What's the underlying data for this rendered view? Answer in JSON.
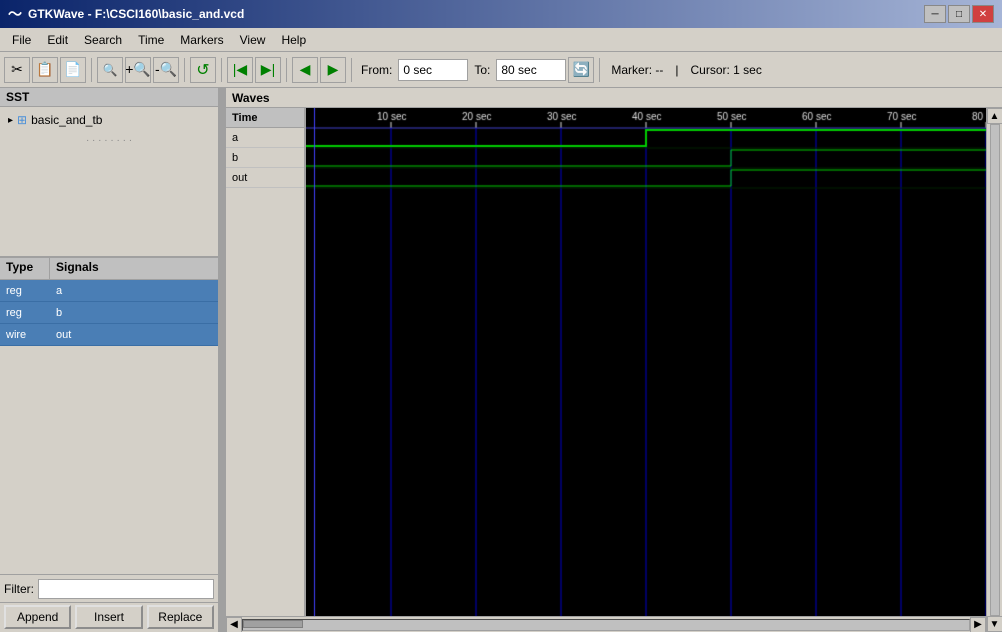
{
  "titlebar": {
    "title": "GTKWave - F:\\CSCI160\\basic_and.vcd",
    "icon": "wave-icon",
    "controls": [
      "minimize",
      "maximize",
      "close"
    ]
  },
  "menubar": {
    "items": [
      "File",
      "Edit",
      "Search",
      "Time",
      "Markers",
      "View",
      "Help"
    ]
  },
  "toolbar": {
    "from_label": "From:",
    "from_value": "0 sec",
    "to_label": "To:",
    "to_value": "80 sec",
    "marker_label": "Marker: --",
    "cursor_label": "Cursor: 1 sec"
  },
  "sst": {
    "title": "SST",
    "tree": {
      "item": "basic_and_tb"
    }
  },
  "signals_panel": {
    "col_type": "Type",
    "col_signals": "Signals",
    "signals": [
      {
        "type": "reg",
        "name": "a"
      },
      {
        "type": "reg",
        "name": "b"
      },
      {
        "type": "wire",
        "name": "out"
      }
    ]
  },
  "filter": {
    "label": "Filter:"
  },
  "buttons": {
    "append": "Append",
    "insert": "Insert",
    "replace": "Replace"
  },
  "waves": {
    "title": "Waves",
    "time_col": "Time",
    "signals": [
      "a",
      "b",
      "out"
    ],
    "time_start": 0,
    "time_end": 80,
    "ruler_ticks": [
      {
        "label": "10 sec",
        "pos": 0.125
      },
      {
        "label": "20 sec",
        "pos": 0.25
      },
      {
        "label": "30 sec",
        "pos": 0.375
      },
      {
        "label": "40 sec",
        "pos": 0.5
      },
      {
        "label": "50 sec",
        "pos": 0.625
      },
      {
        "label": "60 sec",
        "pos": 0.75
      },
      {
        "label": "70 sec",
        "pos": 0.875
      },
      {
        "label": "80",
        "pos": 1.0
      }
    ]
  }
}
